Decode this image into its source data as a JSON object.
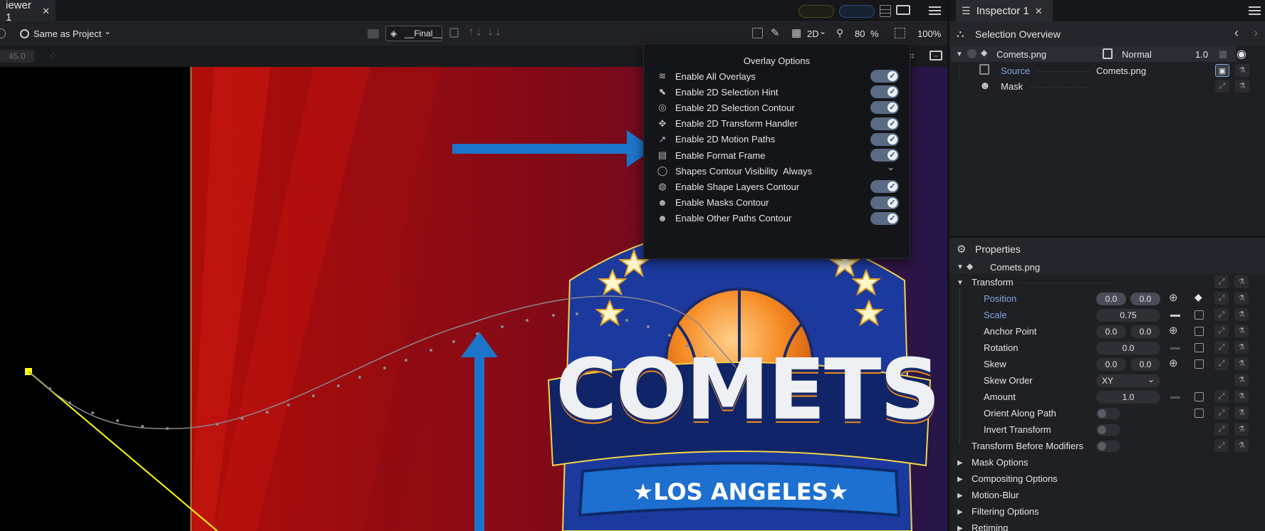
{
  "viewer": {
    "tab_label": "iewer 1",
    "toolbar": {
      "resolution_label": "Same as Project",
      "composition_label": "__Final__",
      "mode_label": "2D",
      "zoom_value": "80",
      "zoom_unit": "%",
      "percent_label": "100%",
      "angle_value": "45.0"
    },
    "overlay_options": {
      "title": "Overlay Options",
      "items": [
        {
          "label": "Enable All Overlays",
          "icon": "stack-eye-icon",
          "glyph": "≋",
          "toggle": true
        },
        {
          "label": "Enable 2D Selection Hint",
          "icon": "cursor-hint-icon",
          "glyph": "⬉",
          "toggle": true
        },
        {
          "label": "Enable 2D Selection Contour",
          "icon": "contour-icon",
          "glyph": "◎",
          "toggle": true
        },
        {
          "label": "Enable 2D Transform Handler",
          "icon": "transform-handle-icon",
          "glyph": "✥",
          "toggle": true
        },
        {
          "label": "Enable 2D Motion Paths",
          "icon": "motion-path-icon",
          "glyph": "↗",
          "toggle": true
        },
        {
          "label": "Enable Format Frame",
          "icon": "layers-icon",
          "glyph": "▤",
          "toggle": true
        },
        {
          "label": "Shapes Contour Visibility",
          "icon": "shape-icon",
          "glyph": "◯",
          "value": "Always"
        },
        {
          "label": "Enable Shape Layers Contour",
          "icon": "shape-layer-icon",
          "glyph": "◍",
          "toggle": true
        },
        {
          "label": "Enable Masks Contour",
          "icon": "mask-icon",
          "glyph": "☻",
          "toggle": true
        },
        {
          "label": "Enable Other Paths Contour",
          "icon": "mask-icon",
          "glyph": "☻",
          "toggle": true
        }
      ]
    },
    "artwork": {
      "team_word": "COMETS",
      "city_label": "★LOS ANGELES★"
    }
  },
  "inspector": {
    "tab_label": "Inspector 1",
    "selection_overview": {
      "title": "Selection Overview",
      "layer_name": "Comets.png",
      "blend_mode": "Normal",
      "opacity": "1.0",
      "source_label": "Source",
      "source_value": "Comets.png",
      "mask_label": "Mask"
    },
    "properties": {
      "title": "Properties",
      "layer_name": "Comets.png",
      "transform_label": "Transform",
      "position_label": "Position",
      "position_x": "0.0",
      "position_y": "0.0",
      "scale_label": "Scale",
      "scale_value": "0.75",
      "anchor_label": "Anchor Point",
      "anchor_x": "0.0",
      "anchor_y": "0.0",
      "rotation_label": "Rotation",
      "rotation_value": "0.0",
      "skew_label": "Skew",
      "skew_x": "0.0",
      "skew_y": "0.0",
      "skew_order_label": "Skew Order",
      "skew_order_value": "XY",
      "amount_label": "Amount",
      "amount_value": "1.0",
      "orient_label": "Orient Along Path",
      "invert_label": "Invert Transform",
      "before_mod_label": "Transform Before Modifiers",
      "groups": [
        "Mask Options",
        "Compositing Options",
        "Motion-Blur",
        "Filtering Options",
        "Retiming"
      ]
    }
  },
  "colors": {
    "accent_blue": "#1d75c9",
    "toggle_on": "#5b6b83",
    "motion_path_yellow": "#ffff00"
  }
}
